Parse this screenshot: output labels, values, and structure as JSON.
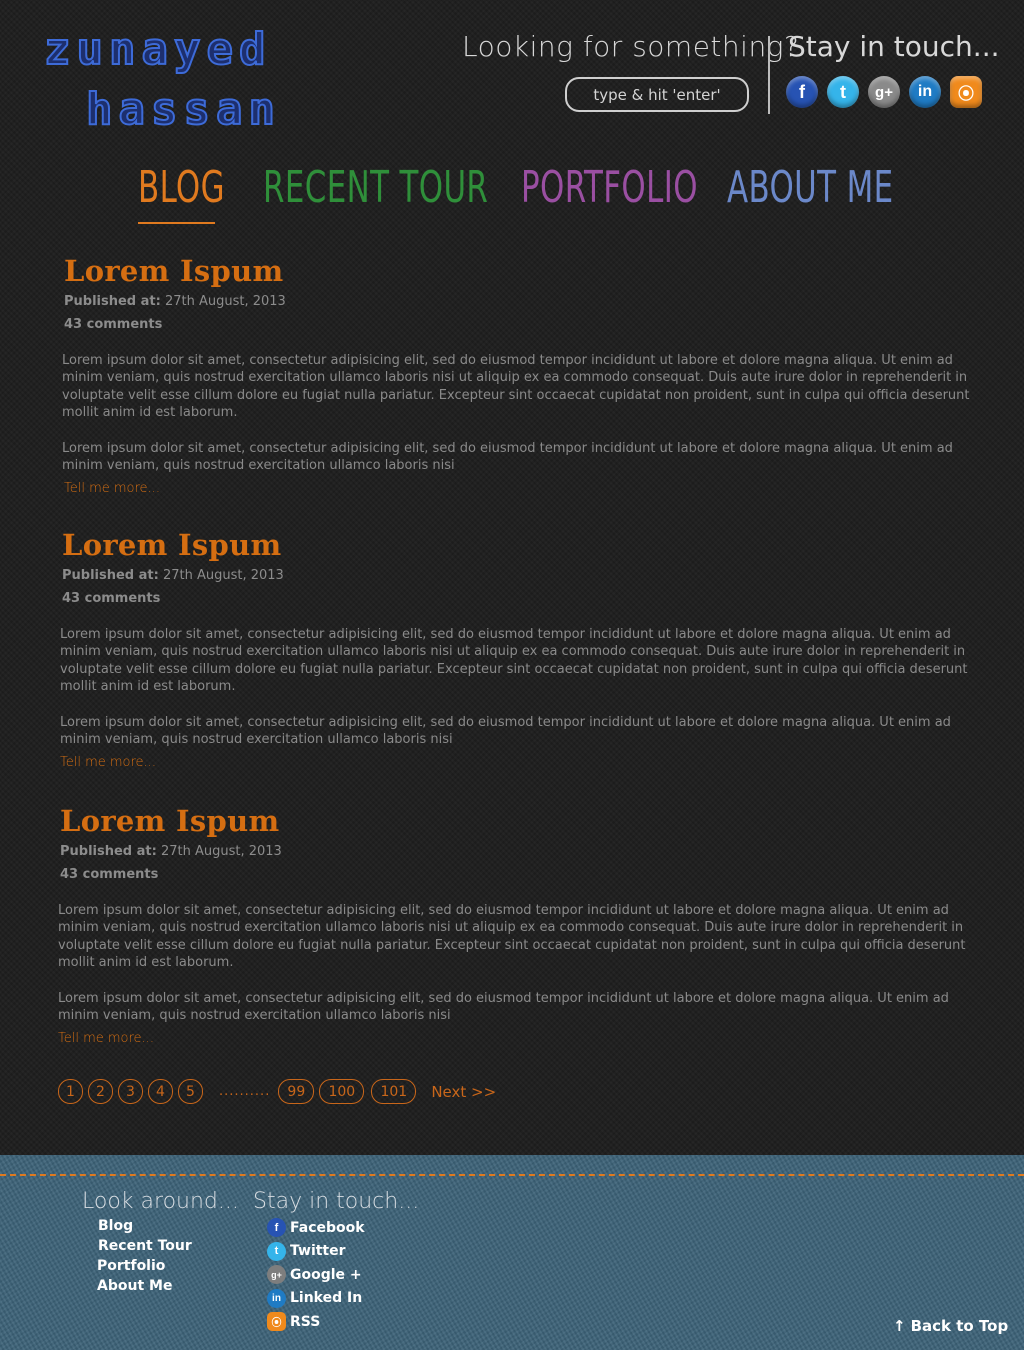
{
  "logo": {
    "line1": "zunayed",
    "line2": "hassan"
  },
  "search": {
    "title": "Looking for something?",
    "placeholder": "type & hit 'enter'"
  },
  "social": {
    "title": "Stay in touch...",
    "icons": [
      "facebook-icon",
      "twitter-icon",
      "google-plus-icon",
      "linkedin-icon",
      "rss-icon"
    ]
  },
  "nav": {
    "items": [
      {
        "label": "BLOG",
        "color": "#e07a1f",
        "active": true
      },
      {
        "label": "RECENT TOUR",
        "color": "#2f8f3a"
      },
      {
        "label": "PORTFOLIO",
        "color": "#9a4fa2"
      },
      {
        "label": "ABOUT ME",
        "color": "#6b88c9"
      }
    ]
  },
  "posts": [
    {
      "title": "Lorem Ispum",
      "published_label": "Published at:",
      "published_date": "27th August, 2013",
      "comments": "43 comments",
      "para1": "Lorem ipsum dolor sit amet, consectetur adipisicing elit, sed do eiusmod tempor incididunt ut labore et dolore magna aliqua. Ut enim ad minim veniam, quis nostrud exercitation ullamco laboris nisi ut aliquip ex ea commodo consequat. Duis aute irure dolor in reprehenderit in voluptate velit esse cillum dolore eu fugiat nulla pariatur. Excepteur sint occaecat cupidatat non proident, sunt in culpa qui officia deserunt mollit anim id est laborum.",
      "para2": "Lorem ipsum dolor sit amet, consectetur adipisicing elit, sed do eiusmod tempor incididunt ut labore et dolore magna aliqua. Ut enim ad minim veniam, quis nostrud exercitation ullamco laboris nisi",
      "more": "Tell me more..."
    },
    {
      "title": "Lorem Ispum",
      "published_label": "Published at:",
      "published_date": "27th August, 2013",
      "comments": "43 comments",
      "para1": "Lorem ipsum dolor sit amet, consectetur adipisicing elit, sed do eiusmod tempor incididunt ut labore et dolore magna aliqua. Ut enim ad minim veniam, quis nostrud exercitation ullamco laboris nisi ut aliquip ex ea commodo consequat. Duis aute irure dolor in reprehenderit in voluptate velit esse cillum dolore eu fugiat nulla pariatur. Excepteur sint occaecat cupidatat non proident, sunt in culpa qui officia deserunt mollit anim id est laborum.",
      "para2": "Lorem ipsum dolor sit amet, consectetur adipisicing elit, sed do eiusmod tempor incididunt ut labore et dolore magna aliqua. Ut enim ad minim veniam, quis nostrud exercitation ullamco laboris nisi",
      "more": "Tell me more..."
    },
    {
      "title": "Lorem Ispum",
      "published_label": "Published at:",
      "published_date": "27th August, 2013",
      "comments": "43 comments",
      "para1": "Lorem ipsum dolor sit amet, consectetur adipisicing elit, sed do eiusmod tempor incididunt ut labore et dolore magna aliqua. Ut enim ad minim veniam, quis nostrud exercitation ullamco laboris nisi ut aliquip ex ea commodo consequat. Duis aute irure dolor in reprehenderit in voluptate velit esse cillum dolore eu fugiat nulla pariatur. Excepteur sint occaecat cupidatat non proident, sunt in culpa qui officia deserunt mollit anim id est laborum.",
      "para2": "Lorem ipsum dolor sit amet, consectetur adipisicing elit, sed do eiusmod tempor incididunt ut labore et dolore magna aliqua. Ut enim ad minim veniam, quis nostrud exercitation ullamco laboris nisi",
      "more": "Tell me more..."
    }
  ],
  "pagination": {
    "pages": [
      "1",
      "2",
      "3",
      "4",
      "5"
    ],
    "ellipsis": "..........",
    "last_pages": [
      "99",
      "100",
      "101"
    ],
    "next": "Next >>"
  },
  "footer": {
    "look_title": "Look around...",
    "look_links": [
      "Blog",
      "Recent Tour",
      "Portfolio",
      "About Me"
    ],
    "touch_title": "Stay in touch...",
    "touch_links": [
      {
        "label": "Facebook",
        "icon": "facebook-icon"
      },
      {
        "label": "Twitter",
        "icon": "twitter-icon"
      },
      {
        "label": "Google +",
        "icon": "google-plus-icon"
      },
      {
        "label": "Linked In",
        "icon": "linkedin-icon"
      },
      {
        "label": "RSS",
        "icon": "rss-icon"
      }
    ],
    "back_to_top": "Back to Top",
    "stitch_color": "#e07a1f",
    "background": "#3c6278"
  },
  "colors": {
    "accent": "#d56e12",
    "background": "#1e1e1e"
  }
}
